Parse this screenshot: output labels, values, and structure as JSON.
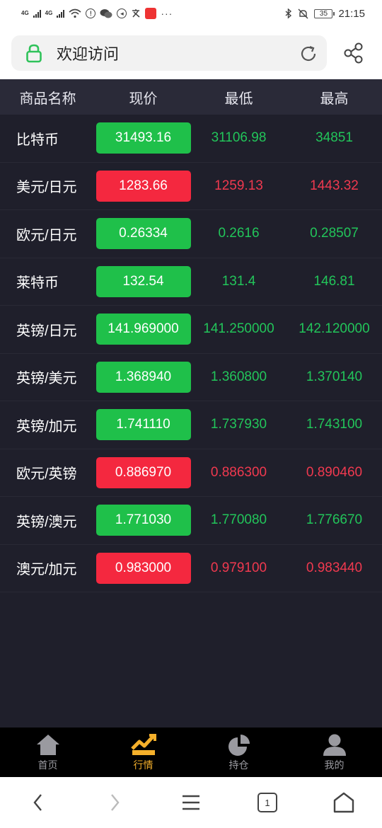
{
  "status_bar": {
    "net1": "4G",
    "net2": "4G",
    "time": "21:15",
    "battery": "35"
  },
  "address_bar": {
    "title": "欢迎访问"
  },
  "table": {
    "headers": [
      "商品名称",
      "现价",
      "最低",
      "最高"
    ],
    "rows": [
      {
        "name": "比特币",
        "price": "31493.16",
        "low": "31106.98",
        "high": "34851",
        "trend": "up"
      },
      {
        "name": "美元/日元",
        "price": "1283.66",
        "low": "1259.13",
        "high": "1443.32",
        "trend": "down"
      },
      {
        "name": "欧元/日元",
        "price": "0.26334",
        "low": "0.2616",
        "high": "0.28507",
        "trend": "up"
      },
      {
        "name": "莱特币",
        "price": "132.54",
        "low": "131.4",
        "high": "146.81",
        "trend": "up"
      },
      {
        "name": "英镑/日元",
        "price": "141.969000",
        "low": "141.250000",
        "high": "142.120000",
        "trend": "up"
      },
      {
        "name": "英镑/美元",
        "price": "1.368940",
        "low": "1.360800",
        "high": "1.370140",
        "trend": "up"
      },
      {
        "name": "英镑/加元",
        "price": "1.741110",
        "low": "1.737930",
        "high": "1.743100",
        "trend": "up"
      },
      {
        "name": "欧元/英镑",
        "price": "0.886970",
        "low": "0.886300",
        "high": "0.890460",
        "trend": "down"
      },
      {
        "name": "英镑/澳元",
        "price": "1.771030",
        "low": "1.770080",
        "high": "1.776670",
        "trend": "up"
      },
      {
        "name": "澳元/加元",
        "price": "0.983000",
        "low": "0.979100",
        "high": "0.983440",
        "trend": "down"
      }
    ]
  },
  "tabs": [
    {
      "label": "首页",
      "icon": "home-icon"
    },
    {
      "label": "行情",
      "icon": "market-chart-icon",
      "active": true
    },
    {
      "label": "持仓",
      "icon": "pie-chart-icon"
    },
    {
      "label": "我的",
      "icon": "user-icon"
    }
  ],
  "nav": {
    "tab_count": "1"
  },
  "colors": {
    "up": "#1fc04a",
    "down": "#f4283f",
    "active_tab": "#f5b02b",
    "background": "#1f1f2b"
  }
}
